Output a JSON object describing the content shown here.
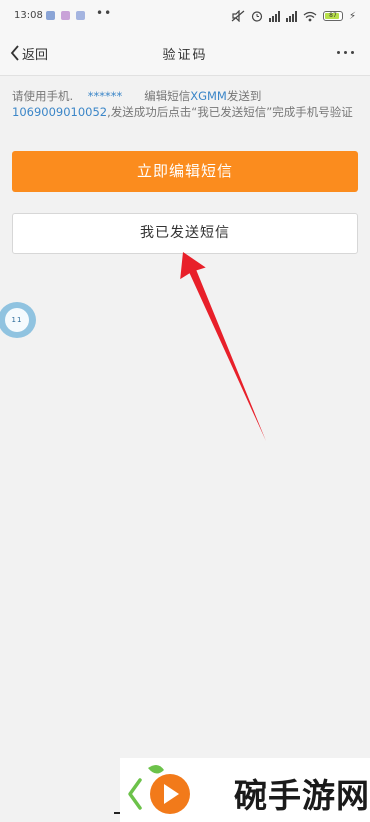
{
  "status_bar": {
    "time": "13:08",
    "battery": "87"
  },
  "nav": {
    "back_label": "返回",
    "title": "验证码"
  },
  "instructions": {
    "prefix": "请使用手机.",
    "masked_phone": "******",
    "mid": "编辑短信",
    "code": "XGMM",
    "to": "发送到",
    "number": "1069009010052",
    "suffix": ",发送成功后点击“我已发送短信”完成手机号验证"
  },
  "buttons": {
    "edit_sms": "立即编辑短信",
    "sent_sms": "我已发送短信"
  },
  "float_ball": {
    "label": "11"
  },
  "watermark": {
    "text": "碗手游网"
  },
  "colors": {
    "accent": "#fb8c1e",
    "link": "#3b86c8",
    "arrow": "#e8202a"
  }
}
